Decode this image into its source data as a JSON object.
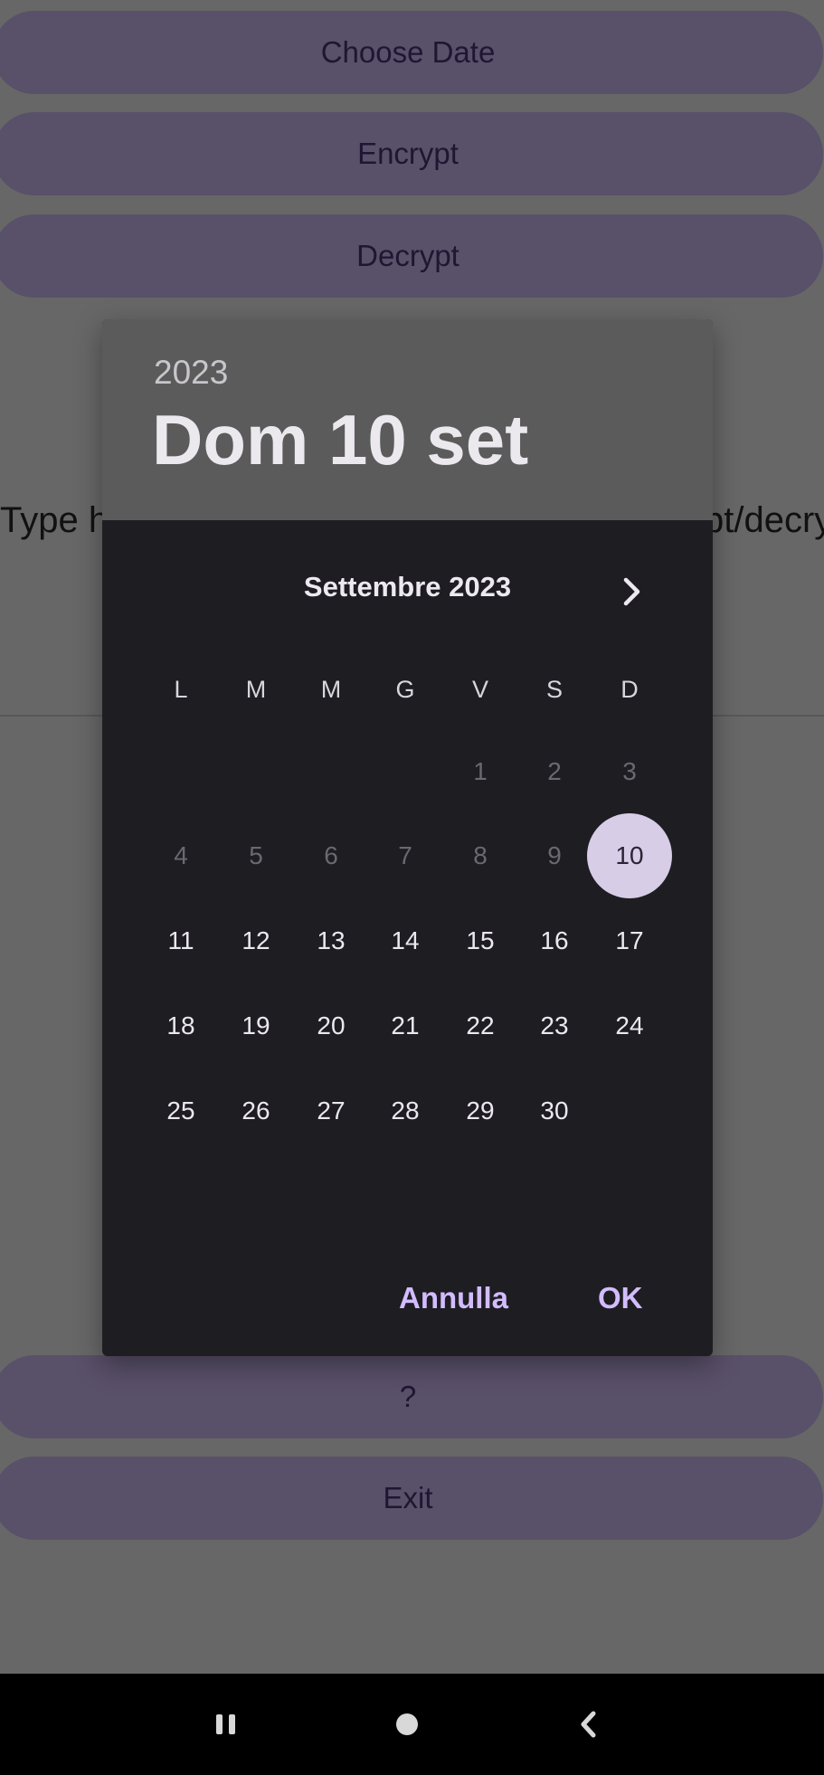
{
  "background": {
    "buttons": {
      "choose_date": "Choose Date",
      "encrypt": "Encrypt",
      "decrypt": "Decrypt",
      "help": "?",
      "exit": "Exit"
    },
    "instruction_left": "Type h",
    "instruction_right": "pt/decry"
  },
  "dialog": {
    "header": {
      "year": "2023",
      "date": "Dom 10 set"
    },
    "month_label": "Settembre 2023",
    "next_icon": "chevron-right-icon",
    "weekdays": [
      "L",
      "M",
      "M",
      "G",
      "V",
      "S",
      "D"
    ],
    "days": {
      "row1": [
        "1",
        "2",
        "3"
      ],
      "row2": [
        "4",
        "5",
        "6",
        "7",
        "8",
        "9",
        "10"
      ],
      "row3": [
        "11",
        "12",
        "13",
        "14",
        "15",
        "16",
        "17"
      ],
      "row4": [
        "18",
        "19",
        "20",
        "21",
        "22",
        "23",
        "24"
      ],
      "row5": [
        "25",
        "26",
        "27",
        "28",
        "29",
        "30"
      ]
    },
    "selected_day": "10",
    "cancel_label": "Annulla",
    "ok_label": "OK"
  },
  "navbar": {
    "recents_icon": "recents-icon",
    "home_icon": "home-icon",
    "back_icon": "back-icon"
  },
  "colors": {
    "scrim": "#676767",
    "header_bg": "#5b5b5b",
    "dialog_bg": "#1e1d22",
    "accent": "#d2bcff",
    "selected_circle": "#d7cde6",
    "button_bg": "#595069"
  }
}
